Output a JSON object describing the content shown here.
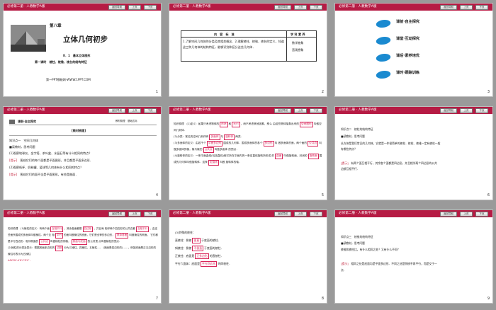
{
  "header": {
    "title": "必修第二册 · 人教数学A版",
    "nav_back": "返回导航",
    "nav_prev": "上页",
    "nav_next": "下页"
  },
  "slides": [
    {
      "num": "1",
      "chapter": "第八章",
      "title": "立体几何初步",
      "section": "8．1　基本立体图形",
      "lesson": "第一课时　棱柱、棱锥、棱台的结构特征",
      "footer": "第一PPT模板网-WWW.1PPT.COM"
    },
    {
      "num": "2",
      "table": {
        "head": [
          "内　容　标　准",
          "学 科 素 养"
        ],
        "body": "1.了解空间几何体的分类及其相关概念．2.理解棱柱、棱锥、棱台的定义，知道这三种几何体的结构特征，能够识别和区分这些几何体．",
        "side": [
          "数学抽象",
          "直观想象"
        ]
      }
    },
    {
      "num": "3",
      "menu": [
        "课前·自主探究",
        "课堂·互动探究",
        "课后·素养培优",
        "课时·跟踪训练"
      ]
    },
    {
      "num": "4",
      "label": "课前·自主探究",
      "label_r": "教材梳理　基础达标",
      "band": "[教材梳理]",
      "lines": [
        "知识点一　空间几何体",
        "■读教材，思考问题",
        "(1)观察地球仪、金字塔、茶叶盒、水晶石等有什么相同的特点？",
        "[提示]　围成它们的每个面都是平面图形，并且都是平面多边形．",
        "(2)观察纸杯、奶粉罐、篮球等几何体有什么相同的特点？",
        "[提示]　围成它们的面不全是平面图形，有些是曲面．"
      ]
    },
    {
      "num": "5",
      "lines": [
        "知识梳理　(1)定义：如果只考虑物体的",
        "形状",
        "和",
        "大小",
        "，而不考虑其他因素，那么",
        "由这些物体抽象出来的",
        "空间图形",
        "叫做空间几何体．",
        "(2)分类：常见的空间几何体有",
        "多面体",
        "与",
        "旋转体",
        "两类．",
        "(3)多面体的定义：由若干个",
        "平面多边形",
        "围成的几何体．围成多面体的各个",
        "多边形",
        "叫",
        "做多面体的面，两个面的",
        "公共边",
        "叫做多面体的棱，棱与棱的",
        "公共点",
        "叫做多面体",
        "的顶点．",
        "(4)旋转体的定义：一条平面曲线(包括直线)绕它所在平面内的一条定直线旋转所形成",
        "的",
        "曲面",
        "叫做旋转面，封闭的",
        "旋转面",
        "围成的几何体叫做旋转体．这条",
        "定直线",
        "叫做",
        "旋转体的轴．"
      ]
    },
    {
      "num": "6",
      "lines": [
        "知识点二　棱柱的结构特征",
        "■读教材，思考问题",
        "长方体是我们常见的几何体，它就是一件很简单的棱柱．棱柱、棱锥一定有棱柱一般",
        "有哪些特点？",
        "[提示]　有两个面互相平行，其余各个面都是四边形，并且相邻两个四边形的公共",
        "边都互相平行．"
      ]
    },
    {
      "num": "7",
      "lines": [
        "知识梳理　(1)棱柱的定义：有两个面",
        "互相平行",
        "，其余各面都是",
        "四边形",
        "，并且每",
        "相邻两个四边形的公共边都",
        "互相平行",
        "，由这些面所围成的多面体叫做棱柱．两个互",
        "相",
        "平行",
        "的面叫做棱柱的底面，它们是全等的多边形，",
        "其余各面",
        "叫做棱柱的侧面，",
        "它们都是平行四边形．相邻侧面的",
        "公共边",
        "叫做棱柱的侧棱，",
        "侧面与底面",
        "的公共顶",
        "点叫做棱柱的顶点．",
        "(2)棱柱的分类及表示：根据底面多边形的",
        "边数",
        "分为三棱柱、四棱柱、五棱柱…．",
        "(底面是四边形的)……，例如底面是正五边形的棱柱可表示为五棱柱",
        "ABCDE-A′B′C′D′E′．"
      ]
    },
    {
      "num": "8",
      "lines": [
        "(3)特殊的棱柱：",
        "直棱柱：侧棱",
        "垂直",
        "于底面的棱柱．",
        "斜棱柱：侧棱",
        "不垂直",
        "于底面的棱柱．",
        "正棱柱：底面是",
        "正多边形",
        "的直棱柱．",
        "平行六面体：底面是",
        "平行四边形",
        "的四棱柱．"
      ]
    },
    {
      "num": "9",
      "lines": [
        "知识点三　棱锥的结构特征",
        "■读教材，思考问题",
        "棱锥和棱柱比，有什么相同之处？又有什么不同？",
        "[提示]　相同之处是底面均是平面多边形．不同之处是侧棱不再平行，而是交于一",
        "点．"
      ]
    }
  ]
}
